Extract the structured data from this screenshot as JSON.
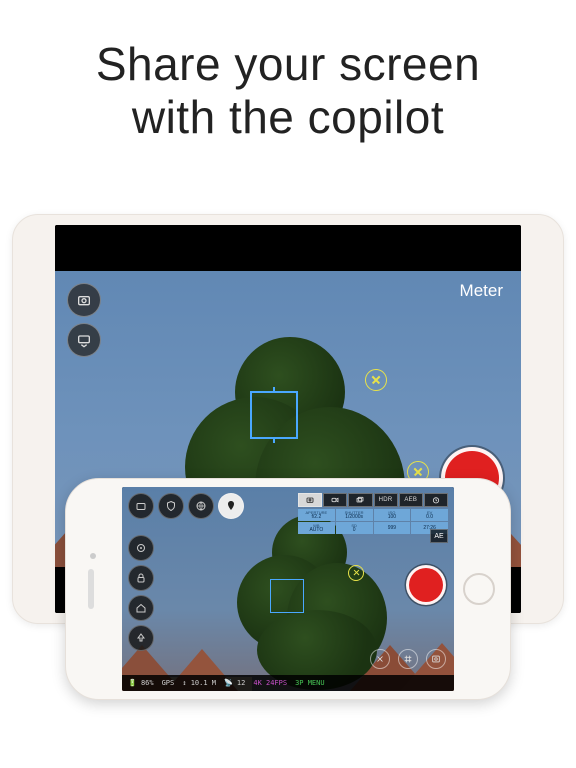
{
  "headline_line1": "Share your screen",
  "headline_line2": "with the copilot",
  "tablet": {
    "meter_label": "Meter"
  },
  "phone": {
    "modes": {
      "photo": "",
      "video": "",
      "burst": "",
      "hdr": "HDR",
      "aeb": "AEB",
      "interval": ""
    },
    "info": {
      "aperture_label": "APERTURE",
      "aperture": "f/2.2",
      "shutter_label": "SHUTTER",
      "shutter": "1/2000s",
      "iso_label": "ISO",
      "iso": "100",
      "ev_label": "EV",
      "ev": "0.0",
      "wb_label": "WB",
      "wb": "AUTO",
      "sd_label": "SD",
      "sd": "0",
      "cap_label": "",
      "cap": "999",
      "time_label": "",
      "time": "27:26"
    },
    "ae_label": "AE",
    "status": {
      "battery": "86%",
      "gps": "GPS",
      "altitude": "10.1 M",
      "satellites": "12",
      "video_mode": "4K 24FPS",
      "extra": "3P  MENU"
    }
  }
}
